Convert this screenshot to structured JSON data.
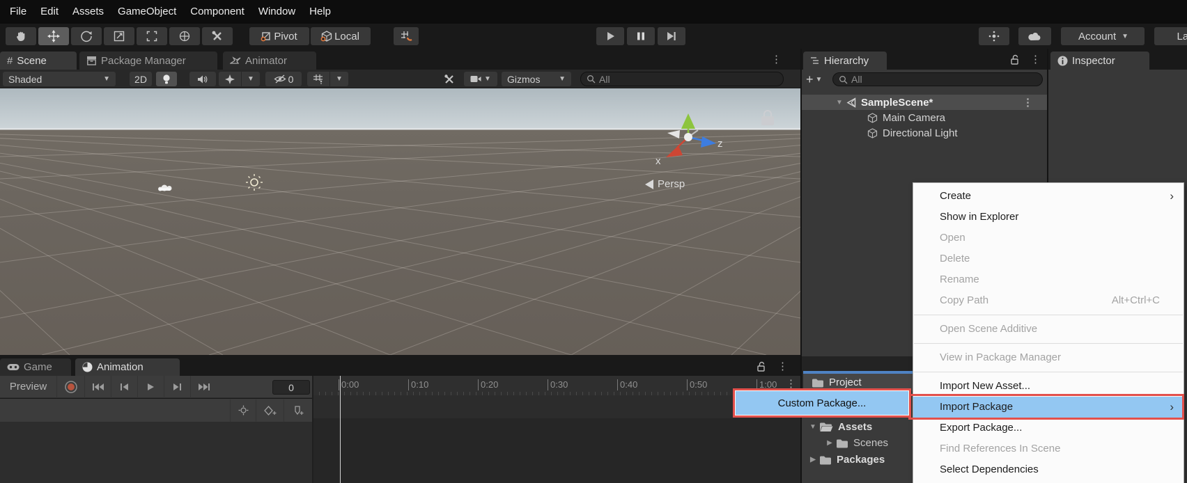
{
  "menu_bar": {
    "items": [
      "File",
      "Edit",
      "Assets",
      "GameObject",
      "Component",
      "Window",
      "Help"
    ]
  },
  "toolbar": {
    "pivot_label": "Pivot",
    "local_label": "Local",
    "account_label": "Account",
    "layers_label": "Layers"
  },
  "scene_panel": {
    "tabs": {
      "scene": "Scene",
      "package_manager": "Package Manager",
      "animator": "Animator"
    },
    "toolbar": {
      "shading_mode": "Shaded",
      "two_d": "2D",
      "hidden_count": "0",
      "gizmos": "Gizmos",
      "search_text": "All"
    },
    "viewport": {
      "x_axis": "x",
      "z_axis": "z",
      "projection": "Persp"
    }
  },
  "hierarchy_panel": {
    "tab": "Hierarchy",
    "search_text": "All",
    "items": [
      {
        "label": "SampleScene*"
      },
      {
        "label": "Main Camera"
      },
      {
        "label": "Directional Light"
      }
    ]
  },
  "inspector_panel": {
    "tab": "Inspector"
  },
  "animation_panel": {
    "tabs": {
      "game": "Game",
      "animation": "Animation"
    },
    "preview_label": "Preview",
    "frame_value": "0",
    "ruler": [
      "0:00",
      "0:10",
      "0:20",
      "0:30",
      "0:40",
      "0:50",
      "1:00"
    ]
  },
  "project_panel": {
    "tab": "Project",
    "tree": [
      {
        "label": "Assets"
      },
      {
        "label": "Scenes"
      },
      {
        "label": "Packages"
      }
    ]
  },
  "context_menu": {
    "items": [
      {
        "label": "Create",
        "submenu_arrow": "›"
      },
      {
        "label": "Show in Explorer"
      },
      {
        "label": "Open"
      },
      {
        "label": "Delete"
      },
      {
        "label": "Rename"
      },
      {
        "label": "Copy Path",
        "shortcut": "Alt+Ctrl+C"
      },
      {
        "label": "Open Scene Additive"
      },
      {
        "label": "View in Package Manager"
      },
      {
        "label": "Import New Asset..."
      },
      {
        "label": "Import Package",
        "submenu_arrow": "›"
      },
      {
        "label": "Export Package..."
      },
      {
        "label": "Find References In Scene"
      },
      {
        "label": "Select Dependencies"
      }
    ]
  },
  "submenu": {
    "items": [
      {
        "label": "Custom Package..."
      }
    ]
  },
  "colors": {
    "highlight_blue": "#93c7f2",
    "annotation_red": "#e2504c",
    "tab_accent_blue": "#4f83c4"
  }
}
